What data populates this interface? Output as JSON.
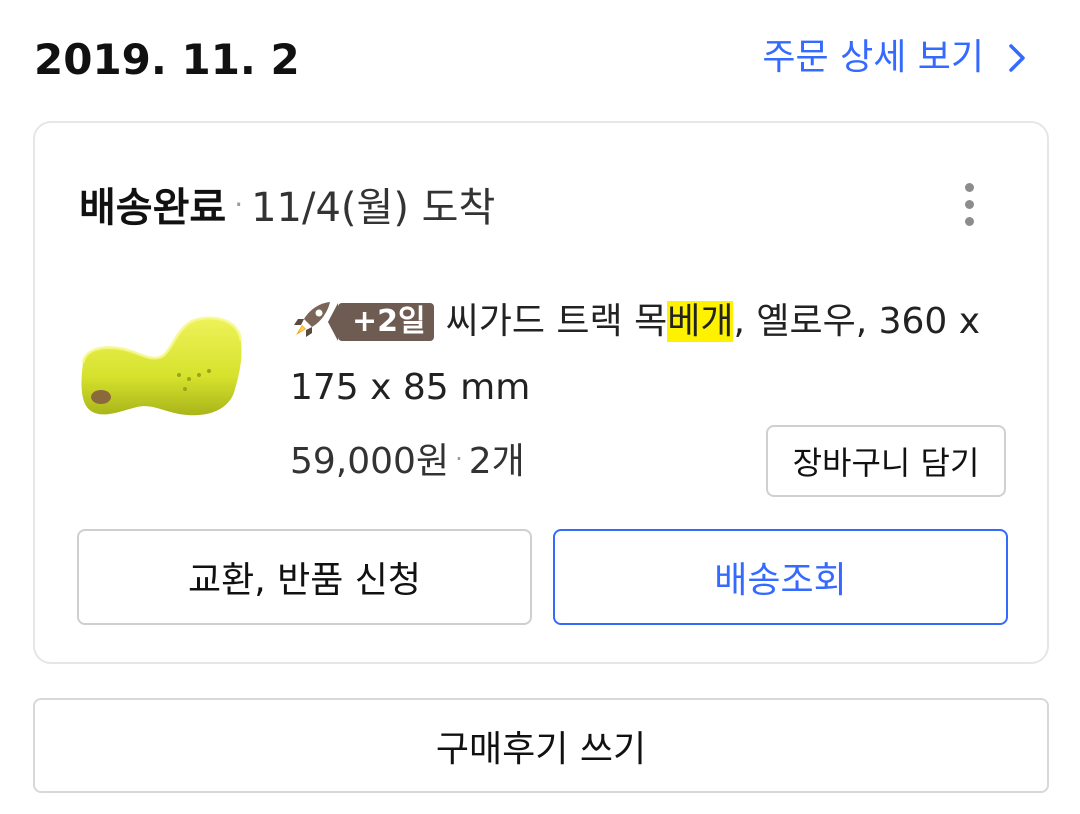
{
  "header": {
    "order_date": "2019. 11. 2",
    "detail_link_label": "주문 상세 보기",
    "chevron_icon": "chevron-right-icon"
  },
  "shipment": {
    "status": "배송완료",
    "separator": "·",
    "arrival": "11/4(월) 도착",
    "menu_icon": "more-vertical-icon"
  },
  "product": {
    "image_icon": "pillow-product-image",
    "rocket_icon": "rocket-icon",
    "badge": "+2일",
    "name_before_highlight": "씨가드 트랙 목",
    "name_highlight": "베개",
    "name_after_highlight": ", 옐로우, 360 x 175 x 85 mm",
    "price": "59,000원",
    "separator": "·",
    "quantity": "2개",
    "cart_button_label": "장바구니 담기"
  },
  "actions": {
    "exchange_label": "교환, 반품 신청",
    "track_label": "배송조회",
    "review_label": "구매후기 쓰기"
  },
  "colors": {
    "accent": "#346aff",
    "badge": "#6e5b51",
    "highlight": "#fff200"
  }
}
